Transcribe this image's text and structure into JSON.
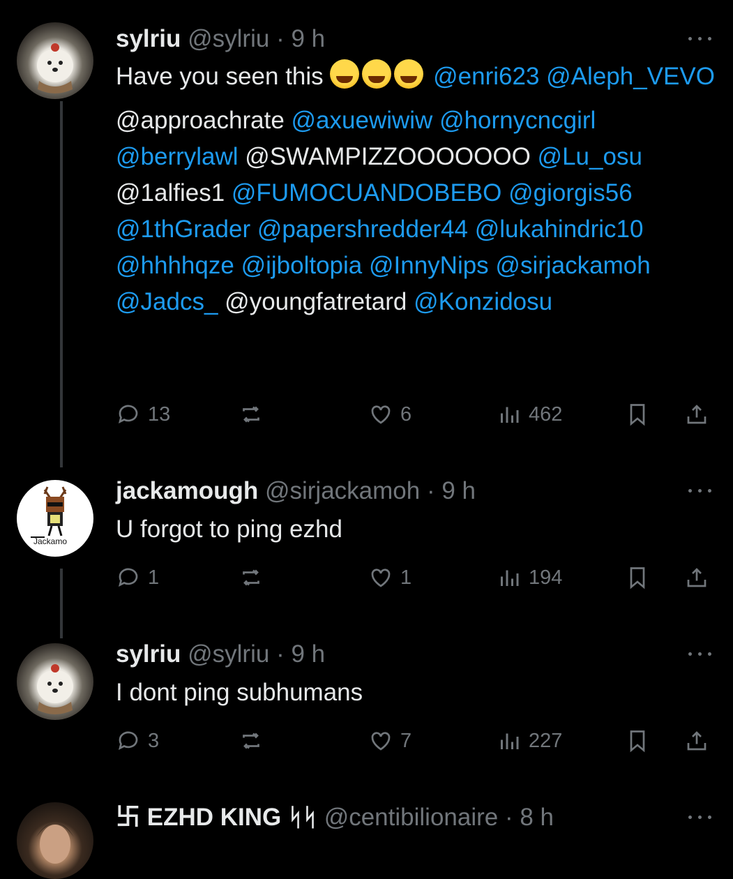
{
  "tweets": [
    {
      "name": "sylriu",
      "handle": "@sylriu",
      "time": "· 9 h",
      "body": [
        [
          "Have you seen this ",
          "t"
        ],
        [
          "😂😂😂",
          "e"
        ],
        [
          " ",
          "t"
        ],
        [
          "@enri623",
          "m"
        ],
        [
          " ",
          "t"
        ],
        [
          "@Aleph_VEVO",
          "m"
        ],
        [
          " @approachrate ",
          "t"
        ],
        [
          "@axuewiwiw",
          "m"
        ],
        [
          " ",
          "t"
        ],
        [
          "@hornycncgirl",
          "m"
        ],
        [
          " ",
          "t"
        ],
        [
          "@berrylawl",
          "m"
        ],
        [
          " @SWAMPIZZOOOOOOO ",
          "t"
        ],
        [
          "@Lu_osu",
          "m"
        ],
        [
          " @1alfies1 ",
          "t"
        ],
        [
          "@FUMOCUANDOBEBO",
          "m"
        ],
        [
          " ",
          "t"
        ],
        [
          "@giorgis56",
          "m"
        ],
        [
          " ",
          "t"
        ],
        [
          "@1thGrader",
          "m"
        ],
        [
          " ",
          "t"
        ],
        [
          "@papershredder44",
          "m"
        ],
        [
          " ",
          "t"
        ],
        [
          "@lukahindric10",
          "m"
        ],
        [
          " ",
          "t"
        ],
        [
          "@hhhhqze",
          "m"
        ],
        [
          " ",
          "t"
        ],
        [
          "@ijboltopia",
          "m"
        ],
        [
          " ",
          "t"
        ],
        [
          "@InnyNips",
          "m"
        ],
        [
          " ",
          "t"
        ],
        [
          "@sirjackamoh",
          "m"
        ],
        [
          " ",
          "t"
        ],
        [
          "@Jadcs_",
          "m"
        ],
        [
          " @youngfatretard ",
          "t"
        ],
        [
          "@Konzidosu",
          "m"
        ]
      ],
      "replies": "13",
      "reposts": "",
      "likes": "6",
      "views": "462"
    },
    {
      "name": "jackamough",
      "handle": "@sirjackamoh",
      "time": "· 9 h",
      "avatar_label": "Jackamo",
      "body": [
        [
          "U forgot to ping ezhd",
          "t"
        ]
      ],
      "replies": "1",
      "reposts": "",
      "likes": "1",
      "views": "194"
    },
    {
      "name": "sylriu",
      "handle": "@sylriu",
      "time": "· 9 h",
      "body": [
        [
          "I dont ping subhumans",
          "t"
        ]
      ],
      "replies": "3",
      "reposts": "",
      "likes": "7",
      "views": "227"
    },
    {
      "name": "卐 EZHD KING ᛋᛋ",
      "handle": "@centibilionaire",
      "time": "· 8 h"
    }
  ],
  "colors": {
    "background": "#000000",
    "text": "#e7e9ea",
    "muted": "#71767b",
    "mention": "#1d9bf0"
  }
}
